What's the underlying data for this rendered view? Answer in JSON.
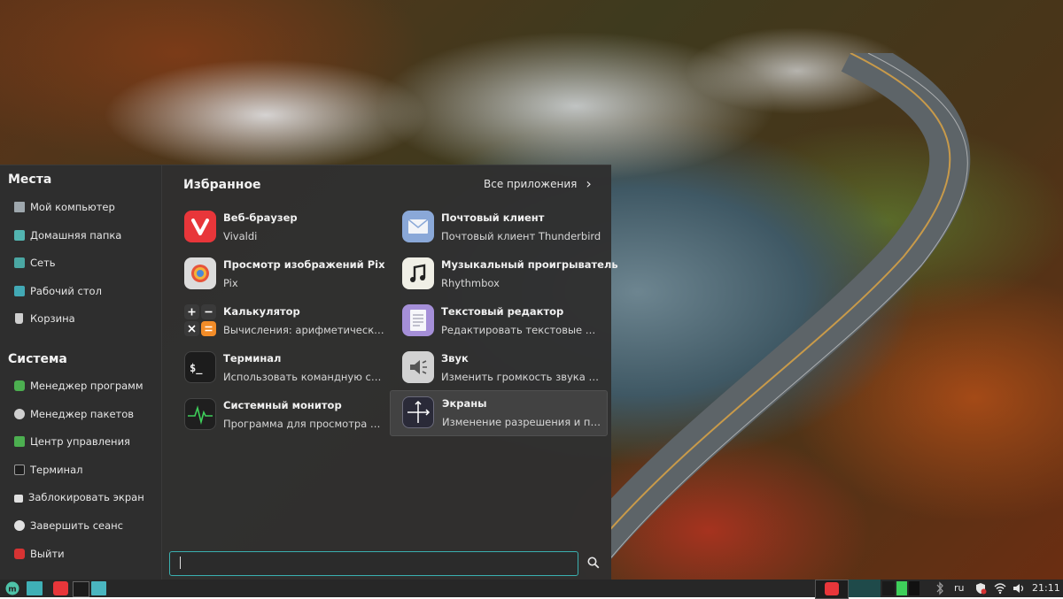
{
  "places": {
    "title": "Места",
    "items": [
      {
        "label": "Мой компьютер"
      },
      {
        "label": "Домашняя папка"
      },
      {
        "label": "Сеть"
      },
      {
        "label": "Рабочий стол"
      },
      {
        "label": "Корзина"
      }
    ]
  },
  "system": {
    "title": "Система",
    "items": [
      {
        "label": "Менеджер программ"
      },
      {
        "label": "Менеджер пакетов"
      },
      {
        "label": "Центр управления"
      },
      {
        "label": "Терминал"
      },
      {
        "label": "Заблокировать экран"
      },
      {
        "label": "Завершить сеанс"
      },
      {
        "label": "Выйти"
      }
    ]
  },
  "favorites": {
    "title": "Избранное",
    "all_apps_label": "Все приложения",
    "apps": [
      {
        "name": "Веб-браузер",
        "desc": "Vivaldi",
        "icon": "vivaldi-icon"
      },
      {
        "name": "Почтовый клиент",
        "desc": "Почтовый клиент Thunderbird",
        "icon": "mail-icon"
      },
      {
        "name": "Просмотр изображений Pix",
        "desc": "Pix",
        "icon": "pix-icon"
      },
      {
        "name": "Музыкальный проигрыватель",
        "desc": "Rhythmbox",
        "icon": "music-icon"
      },
      {
        "name": "Калькулятор",
        "desc": "Вычисления: арифметические, научные и финансовые",
        "icon": "calculator-icon"
      },
      {
        "name": "Текстовый редактор",
        "desc": "Редактировать текстовые файлы",
        "icon": "text-editor-icon"
      },
      {
        "name": "Терминал",
        "desc": "Использовать командную строку",
        "icon": "terminal-icon"
      },
      {
        "name": "Звук",
        "desc": "Изменить громкость звука и сопоставить события со звуками",
        "icon": "sound-icon"
      },
      {
        "name": "Системный монитор",
        "desc": "Программа для просмотра текущих процессов",
        "icon": "system-monitor-icon"
      },
      {
        "name": "Экраны",
        "desc": "Изменение разрешения и положения мониторов",
        "icon": "displays-icon"
      }
    ]
  },
  "search": {
    "value": "",
    "placeholder": ""
  },
  "panel": {
    "language": "ru",
    "clock": "21:11"
  },
  "colors": {
    "accent": "#3ab0b0",
    "menu_bg": "#2f2f2f",
    "panel_bg": "#272727"
  }
}
